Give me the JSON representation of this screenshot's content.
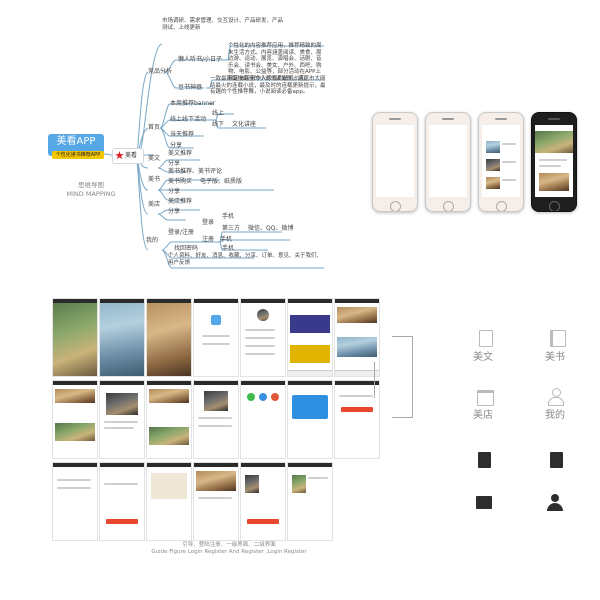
{
  "mindmap": {
    "root_title": "美看APP",
    "root_subtitle": "个性化读书推荐APP",
    "hub_label": "美看",
    "caption_cn": "思维导图",
    "caption_en": "MIND MAPPING",
    "top_note": "市场调研、需求管理、交互设计、产品研发、产品测试、上线更新",
    "competitor_label": "竞品分析",
    "competitor_1_name": "懒人听书/小日子",
    "competitor_1_desc": "个性化的内容推荐应用，推荐精致的周末生活方式。内容涵盖阅读、美食、周边游、运动、展览、演唱会、话剧、音乐会、读书会、美女、户外、西吧、购物、电影、公益等，部分活动在APP上预定参带来令人惊喜的超低价和。",
    "competitor_2_name": "豆书神器",
    "competitor_2_desc": "一款最新最快最全的小说书读软件，涵盖市大网站最火的连载小说，最及时的连载更新提示，最有趣的个性推荐舞，小说阅读必备app。",
    "home_label": "首页",
    "home_items": [
      "本周推荐banner",
      "线上线下活动",
      "当天推荐",
      "分享"
    ],
    "home_activity_items": [
      "线上",
      "线下",
      "文化讲座"
    ],
    "meiwen_label": "美文",
    "meiwen_items": [
      "美文推荐",
      "分享"
    ],
    "meishu_label": "美书",
    "meishu_items": [
      "美书推荐、美书评论",
      "美书购买",
      "电子版、纸质版",
      "分享"
    ],
    "meidian_label": "美店",
    "meidian_items": [
      "美店推荐",
      "分享"
    ],
    "mine_label": "我的",
    "mine_login": "登录/注册",
    "mine_login_branch": "登录",
    "mine_phone": "手机",
    "mine_third": "第三方",
    "mine_third_options": "微信、QQ、微博",
    "mine_register": "注册",
    "mine_forgot": "找回密码",
    "mine_profile": "个人资料、好友、消息、收藏、分享、订单、意见、关于我们、用户反馈"
  },
  "grid": {
    "caption_cn": "引导、登陆注册、一级界面、二级界面",
    "caption_en": "Guide Figure Login Register And Register ,Login Register"
  },
  "icons": {
    "items": [
      {
        "label": "美文",
        "name": "document-outline-icon"
      },
      {
        "label": "美书",
        "name": "book-outline-icon"
      },
      {
        "label": "美店",
        "name": "store-outline-icon"
      },
      {
        "label": "我的",
        "name": "person-outline-icon"
      },
      {
        "label": "",
        "name": "document-solid-icon"
      },
      {
        "label": "",
        "name": "book-solid-icon"
      },
      {
        "label": "",
        "name": "store-solid-icon"
      },
      {
        "label": "",
        "name": "person-solid-icon"
      }
    ],
    "accent": "#e8472e",
    "root_blue": "#55a7e5",
    "root_yellow": "#f3c600"
  }
}
